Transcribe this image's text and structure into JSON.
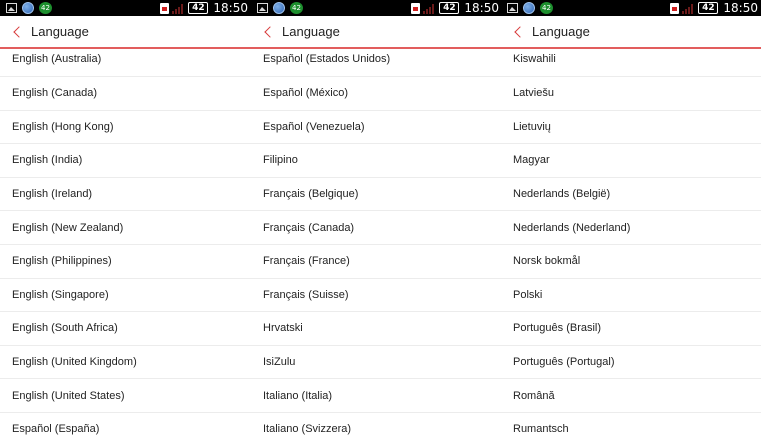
{
  "status_bar": {
    "notification_badge": "42",
    "battery_level": "42",
    "time": "18:50"
  },
  "action_bar": {
    "title": "Language"
  },
  "panels": [
    {
      "items": [
        "English (Australia)",
        "English (Canada)",
        "English (Hong Kong)",
        "English (India)",
        "English (Ireland)",
        "English (New Zealand)",
        "English (Philippines)",
        "English (Singapore)",
        "English (South Africa)",
        "English (United Kingdom)",
        "English (United States)",
        "Español (España)"
      ]
    },
    {
      "items": [
        "Español (Estados Unidos)",
        "Español (México)",
        "Español (Venezuela)",
        "Filipino",
        "Français (Belgique)",
        "Français (Canada)",
        "Français (France)",
        "Français (Suisse)",
        "Hrvatski",
        "IsiZulu",
        "Italiano (Italia)",
        "Italiano (Svizzera)"
      ]
    },
    {
      "items": [
        "Kiswahili",
        "Latviešu",
        "Lietuvių",
        "Magyar",
        "Nederlands (België)",
        "Nederlands (Nederland)",
        "Norsk bokmål",
        "Polski",
        "Português (Brasil)",
        "Português (Portugal)",
        "Română",
        "Rumantsch"
      ]
    }
  ],
  "colors": {
    "accent": "#e25d5d",
    "status_bar_bg": "#000000",
    "text": "#222222"
  },
  "icons": {
    "status_left": [
      "image-icon",
      "globe-icon",
      "notification-count-icon"
    ],
    "status_right": [
      "sim-card-icon",
      "signal-icon",
      "battery-icon"
    ],
    "action_bar": "back-chevron-icon"
  }
}
